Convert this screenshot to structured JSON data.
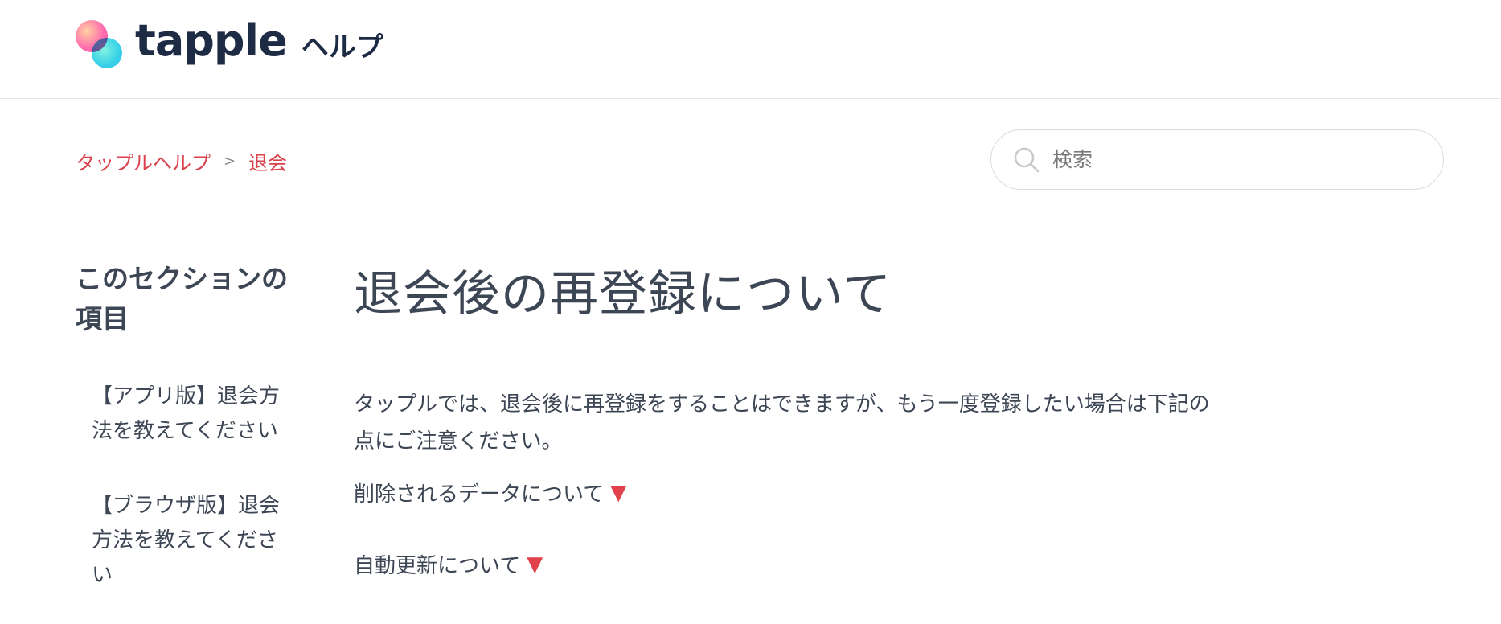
{
  "header": {
    "logo_word": "tapple",
    "logo_help": "ヘルプ"
  },
  "breadcrumb": {
    "items": [
      "タップルヘルプ",
      "退会"
    ],
    "separator": ">"
  },
  "search": {
    "placeholder": "検索"
  },
  "sidebar": {
    "title": "このセクションの項目",
    "links": [
      "【アプリ版】退会方法を教えてください",
      "【ブラウザ版】退会方法を教えてください"
    ]
  },
  "article": {
    "title": "退会後の再登録について",
    "intro": "タップルでは、退会後に再登録をすることはできますが、もう一度登録したい場合は下記の点にご注意ください。",
    "toggles": [
      {
        "label": "削除されるデータについて",
        "marker": "▼"
      },
      {
        "label": "自動更新について",
        "marker": "▼"
      }
    ]
  },
  "colors": {
    "accent": "#e0414a",
    "text": "#3d4654",
    "brand": "#1d2b44"
  }
}
